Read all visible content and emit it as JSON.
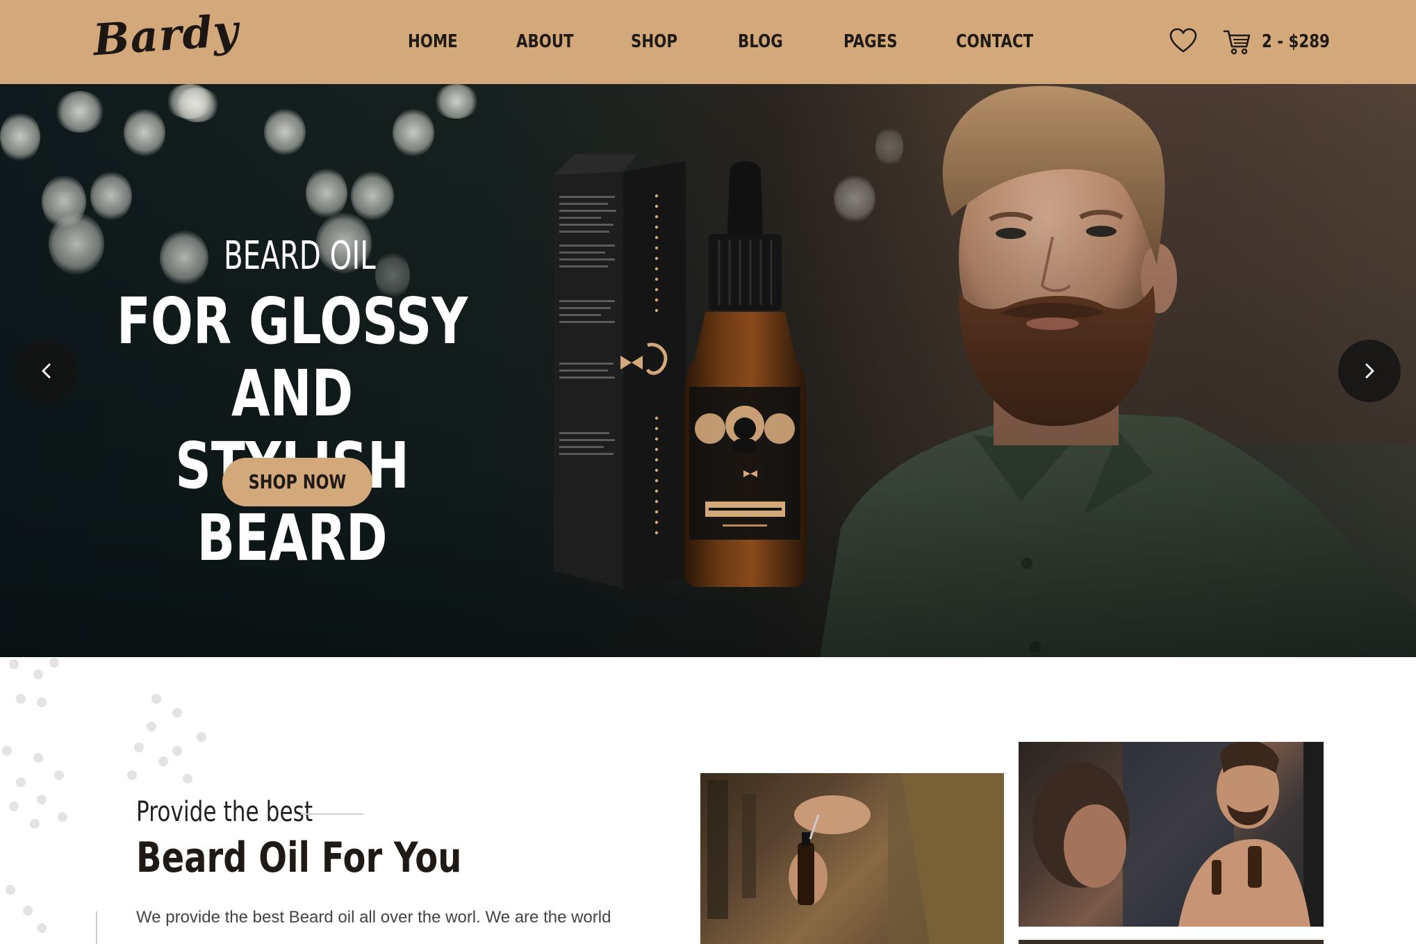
{
  "brand": {
    "logo": "Bardy"
  },
  "nav": {
    "items": [
      {
        "label": "HOME"
      },
      {
        "label": "ABOUT"
      },
      {
        "label": "SHOP"
      },
      {
        "label": "BLOG"
      },
      {
        "label": "PAGES"
      },
      {
        "label": "CONTACT"
      }
    ]
  },
  "header_actions": {
    "wishlist_icon": "heart-icon",
    "cart_icon": "cart-icon",
    "cart_summary": "2 - $289"
  },
  "hero": {
    "eyebrow": "BEARD OIL",
    "title_line1": "FOR GLOSSY AND",
    "title_line2": "STYLISH BEARD",
    "cta": "SHOP NOW",
    "prev_icon": "chevron-left-icon",
    "next_icon": "chevron-right-icon"
  },
  "intro": {
    "kicker": "Provide the best",
    "title": "Beard Oil For You",
    "body": "We provide the best Beard oil all over the worl. We are the world"
  },
  "colors": {
    "accent": "#d3a87b",
    "text_dark": "#1f1a15"
  }
}
